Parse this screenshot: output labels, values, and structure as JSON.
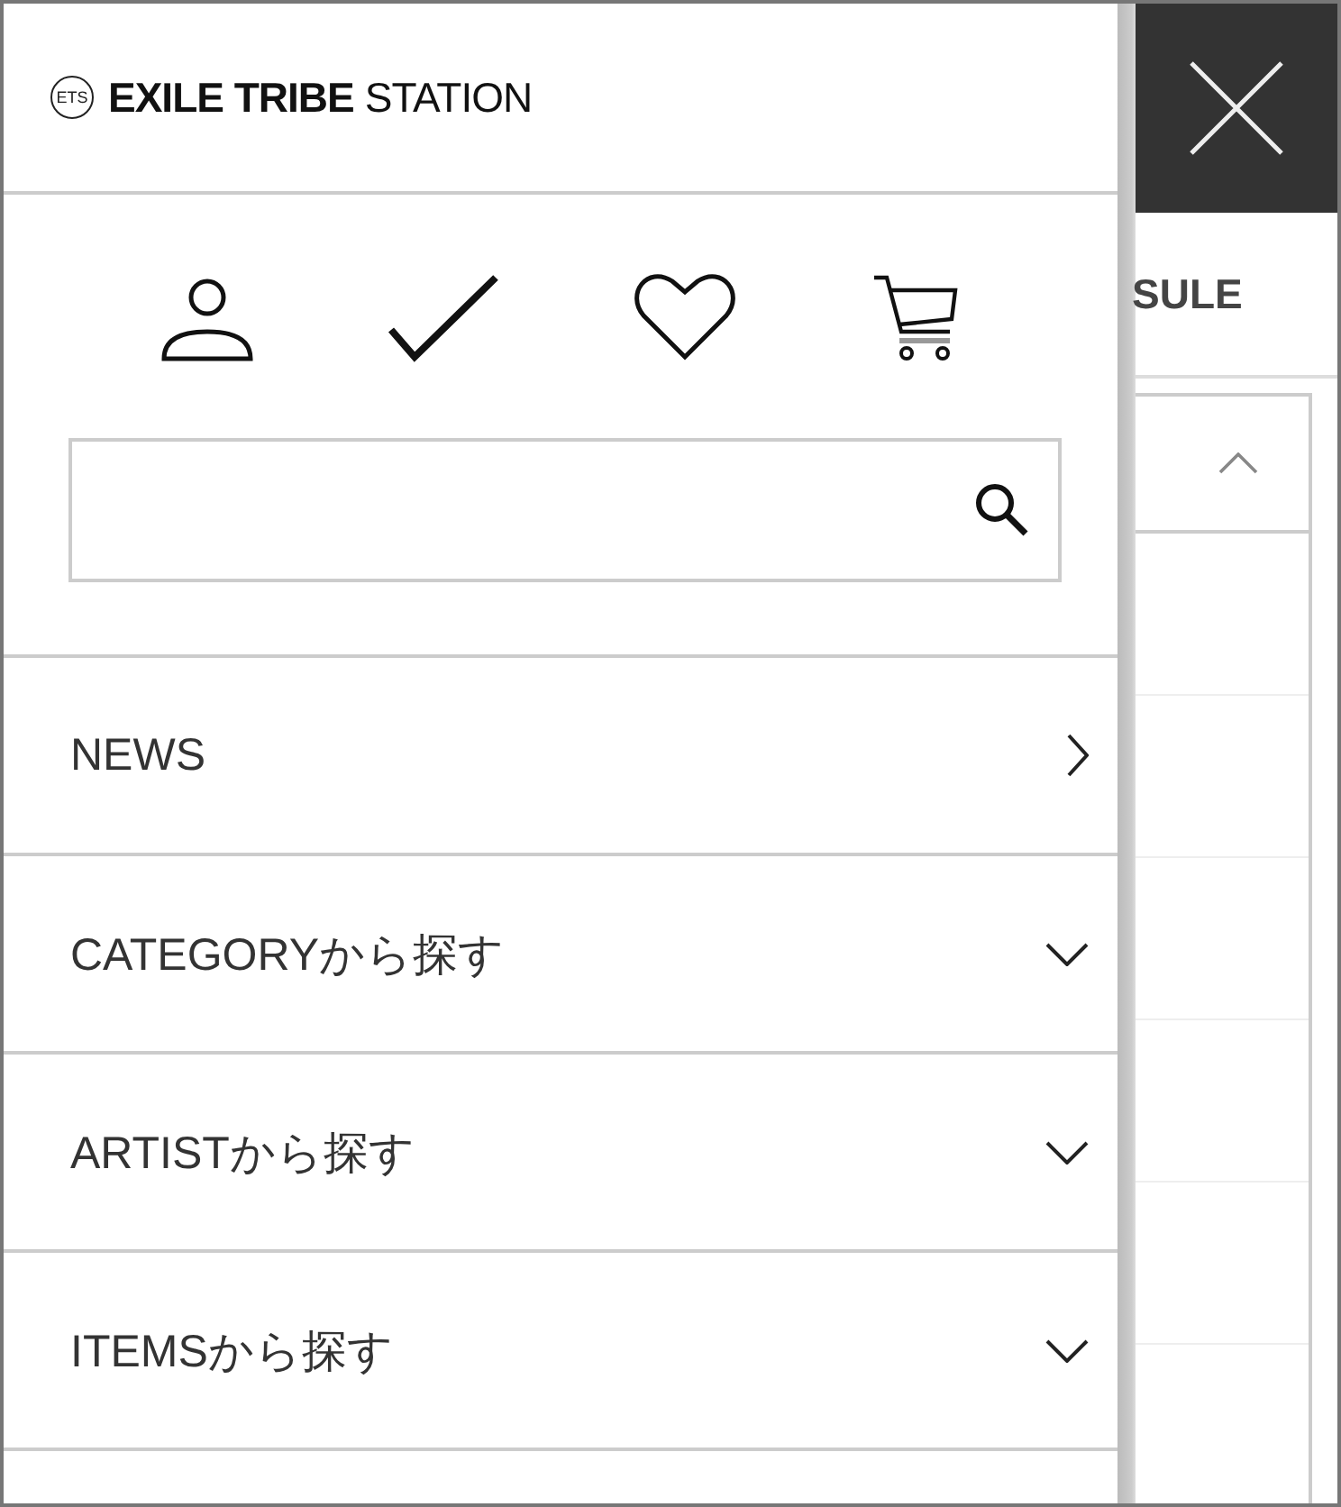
{
  "logo": {
    "mark": "ETS",
    "bold": "EXILE TRIBE",
    "regular": "STATION"
  },
  "menu": [
    {
      "label": "NEWS",
      "kind": "link"
    },
    {
      "label": "CATEGORYから探す",
      "kind": "accordion",
      "expanded": false
    },
    {
      "label": "ARTISTから探す",
      "kind": "accordion",
      "expanded": false
    },
    {
      "label": "ITEMSから探す",
      "kind": "accordion",
      "expanded": false
    }
  ],
  "background": {
    "tab_label": "SULE",
    "panel_expanded": true
  }
}
